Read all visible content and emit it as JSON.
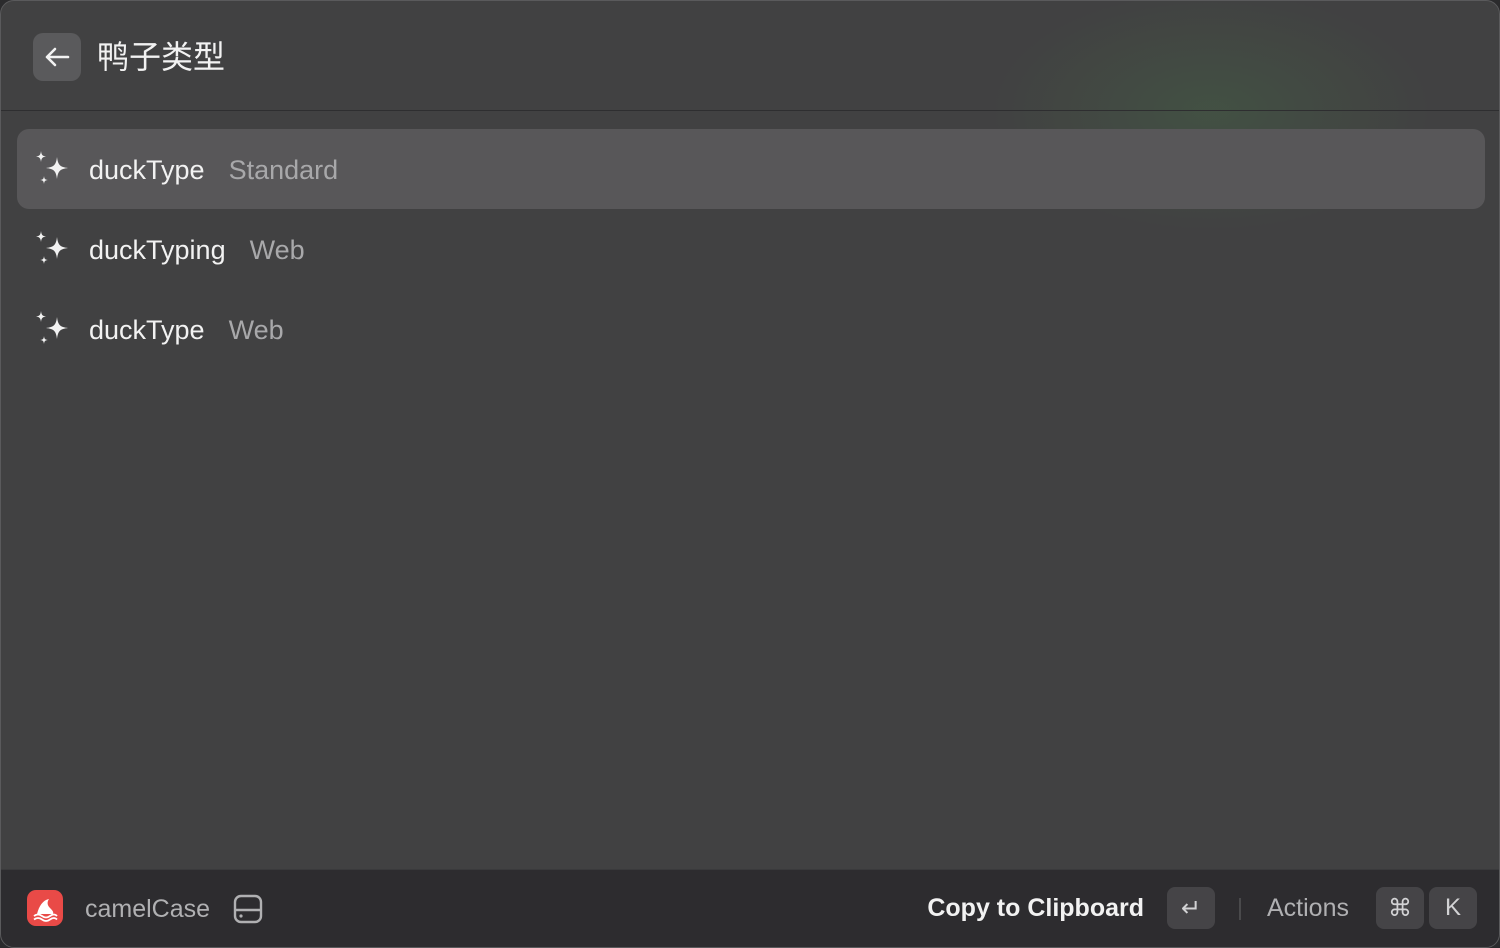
{
  "header": {
    "title": "鸭子类型",
    "back_icon": "arrow-left-icon"
  },
  "results": [
    {
      "title": "duckType",
      "subtitle": "Standard",
      "icon": "sparkles-icon",
      "selected": true
    },
    {
      "title": "duckTyping",
      "subtitle": "Web",
      "icon": "sparkles-icon",
      "selected": false
    },
    {
      "title": "duckType",
      "subtitle": "Web",
      "icon": "sparkles-icon",
      "selected": false
    }
  ],
  "footer": {
    "app_name": "camelCase",
    "app_icon": "camelcase-app-icon",
    "app_icon_color": "#e94a47",
    "drive_icon": "hard-drive-icon",
    "primary_action": "Copy to Clipboard",
    "enter_key": "↵",
    "actions_label": "Actions",
    "cmd_key": "⌘",
    "k_key": "K"
  },
  "colors": {
    "background": "#414142",
    "selected_row": "#585759",
    "footer": "#2d2c2f",
    "title_text": "#f2f2f2",
    "subtitle_text": "#a8a8aa"
  }
}
